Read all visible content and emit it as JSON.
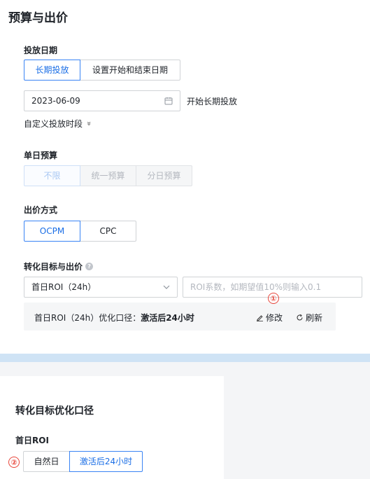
{
  "title": "预算与出价",
  "schedule": {
    "label": "投放日期",
    "options": [
      "长期投放",
      "设置开始和结束日期"
    ],
    "selected_index": 0,
    "start_date": "2023-06-09",
    "start_date_hint": "开始长期投放",
    "custom_link": "自定义投放时段",
    "custom_link_chevron": "»"
  },
  "budget": {
    "label": "单日预算",
    "options": [
      "不限",
      "统一预算",
      "分日预算"
    ],
    "selected_index": 0
  },
  "bid_method": {
    "label": "出价方式",
    "options": [
      "OCPM",
      "CPC"
    ],
    "selected_index": 0
  },
  "conversion": {
    "label": "转化目标与出价",
    "help": "?",
    "target_value": "首日ROI（24h）",
    "roi_placeholder": "ROI系数，如期望值10%则输入0.1",
    "info_prefix": "首日ROI（24h）优化口径：",
    "info_value": "激活后24小时",
    "edit_label": "修改",
    "refresh_label": "刷新",
    "marker_1": "①"
  },
  "optimization": {
    "title": "转化目标优化口径",
    "subtitle": "首日ROI",
    "marker_2": "②",
    "options": [
      "自然日",
      "激活后24小时"
    ],
    "selected_index": 1
  },
  "colors": {
    "accent": "#1a6ee6",
    "marker": "#e8463b",
    "divider_band": "#cfe3f5"
  },
  "icons": [
    "calendar-icon",
    "chevron-down-icon",
    "edit-pencil-icon",
    "refresh-icon",
    "double-chevron-down-icon",
    "help-icon"
  ]
}
